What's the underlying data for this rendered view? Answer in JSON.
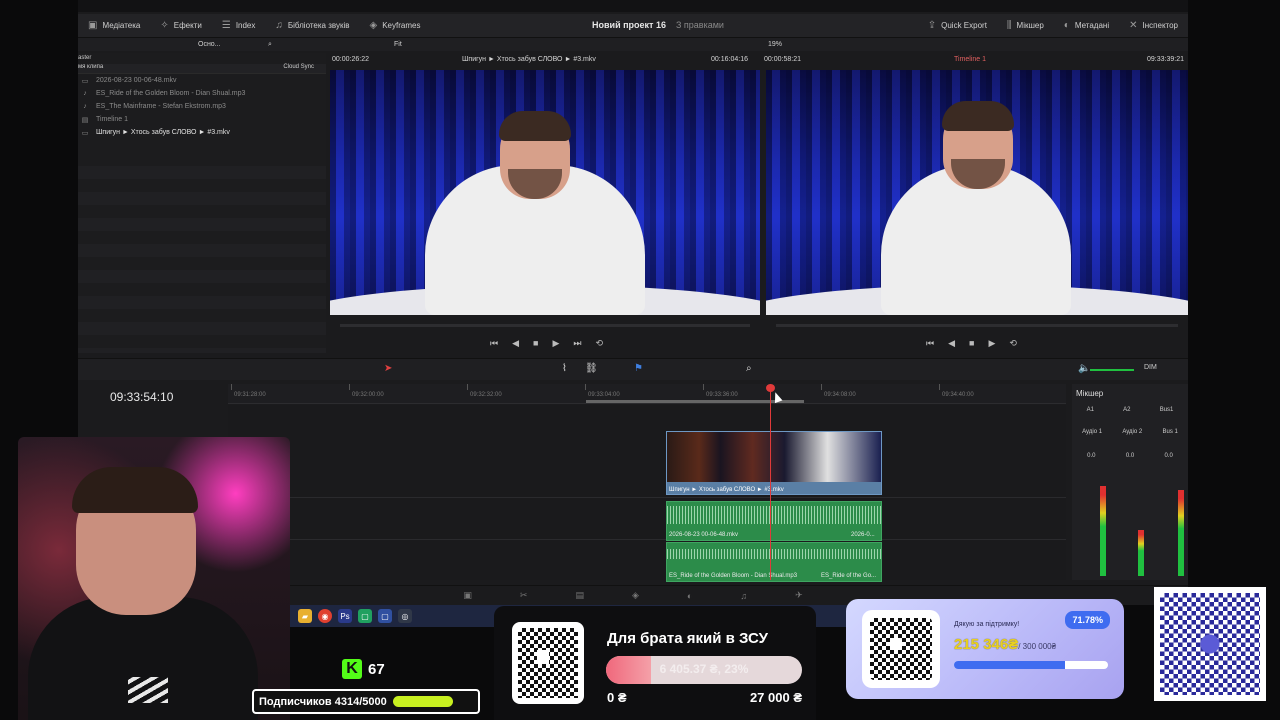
{
  "toolbar": {
    "media_pool": "Медіатека",
    "effects": "Ефекти",
    "index": "Index",
    "sound_library": "Бібліотека звуків",
    "keyframes": "Keyframes",
    "project_title": "Новий проект 16",
    "project_status": "З правками",
    "quick_export": "Quick Export",
    "mixer": "Мікшер",
    "metadata": "Метадані",
    "inspector": "Інспектор"
  },
  "subbar": {
    "view_mode": "Осно...",
    "fit": "Fit",
    "zoom": "19%"
  },
  "pool": {
    "bin": "aster",
    "col_name": "мя клипа",
    "col_sync": "Cloud Sync",
    "items": [
      {
        "name": "2026-08-23 00-06-48.mkv",
        "icon": "film-icon"
      },
      {
        "name": "ES_Ride of the Golden Bloom - Dian Shual.mp3",
        "icon": "music-icon"
      },
      {
        "name": "ES_The Mainframe - Stefan Ekstrom.mp3",
        "icon": "music-icon"
      },
      {
        "name": "Timeline 1",
        "icon": "timeline-icon"
      },
      {
        "name": "Шпигун ► Хтось забув СЛОВО ► #3.mkv",
        "icon": "film-icon"
      }
    ]
  },
  "source_viewer": {
    "tc_left": "00:00:26:22",
    "clip": "Шпигун ► Хтось забув СЛОВО ► #3.mkv",
    "tc_right": "00:16:04:16"
  },
  "program_viewer": {
    "tc_left": "00:00:58:21",
    "timeline": "Timeline 1",
    "tc_right": "09:33:39:21"
  },
  "timeline": {
    "timecode": "09:33:54:10",
    "ruler": [
      "09:31:28:00",
      "09:32:00:00",
      "09:32:32:00",
      "09:33:04:00",
      "09:33:36:00",
      "09:34:08:00",
      "09:34:40:00"
    ],
    "video_clip": "Шпигун ► Хтось забув СЛОВО ► #3.mkv",
    "audio_clip_1": "2026-08-23 00-06-48.mkv",
    "audio_clip_1b": "2026-0...",
    "audio_clip_2": "ES_Ride of the Golden Bloom - Dian Shual.mp3",
    "audio_clip_2b": "ES_Ride of the Go..."
  },
  "mixer": {
    "title": "Мікшер",
    "channels": [
      "A1",
      "A2",
      "Bus1"
    ],
    "names": [
      "Аудіо 1",
      "Аудіо 2",
      "Bus 1"
    ],
    "levels": [
      "0.0",
      "0.0",
      "0.0"
    ],
    "dim": "DIM"
  },
  "overlay": {
    "kick_count": "67",
    "subs_text": "Подписчиков 4314/5000",
    "donation_title": "Для брата який в ЗСУ",
    "donation_value": "6 405.37 ₴, 23%",
    "donation_percent": 23,
    "donation_min": "0 ₴",
    "donation_max": "27 000 ₴",
    "support_message": "Дякую за підтримку!",
    "support_percent": "71.78%",
    "support_percent_value": 71.78,
    "support_amount": "215 346₴",
    "support_goal": "/ 300 000₴"
  },
  "colors": {
    "accent_red": "#e03a3a",
    "clip_video": "#5a7fa5",
    "clip_audio": "#2c8c4a",
    "kick_green": "#53fc18",
    "support_blue": "#3f6cf0"
  }
}
